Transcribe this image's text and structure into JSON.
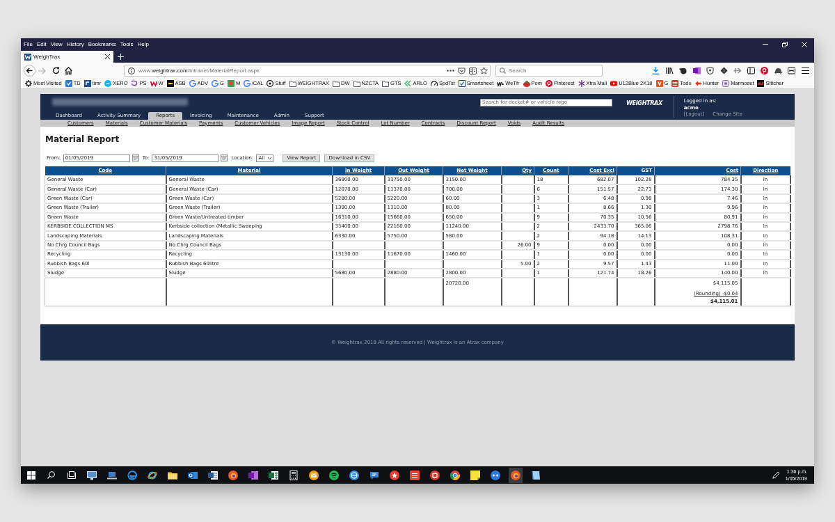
{
  "browser": {
    "menu": [
      "File",
      "Edit",
      "View",
      "History",
      "Bookmarks",
      "Tools",
      "Help"
    ],
    "tabs": [
      {
        "label": "WeighTrax",
        "selected": true
      }
    ],
    "forward_disabled": true,
    "url": {
      "prefix": "www.",
      "domain": "weightrax.com",
      "path": "/Intranet/MaterialReport.aspx"
    },
    "search": {
      "placeholder": "Search"
    },
    "bookmarks": [
      {
        "label": "Most Visited",
        "kind": "menu"
      },
      {
        "label": "TD",
        "kind": "link"
      },
      {
        "label": "timr",
        "kind": "link"
      },
      {
        "label": "XERO",
        "kind": "link"
      },
      {
        "label": "PS",
        "kind": "link"
      },
      {
        "label": "W",
        "kind": "link"
      },
      {
        "label": "ASB",
        "kind": "link"
      },
      {
        "label": "ADV",
        "kind": "link"
      },
      {
        "label": "G",
        "kind": "link"
      },
      {
        "label": "M",
        "kind": "link"
      },
      {
        "label": "iCAL",
        "kind": "link"
      },
      {
        "label": "Stuff",
        "kind": "link"
      },
      {
        "label": "WEIGHTRAX",
        "kind": "folder"
      },
      {
        "label": "DW",
        "kind": "folder"
      },
      {
        "label": "NZCTA",
        "kind": "folder"
      },
      {
        "label": "GTS",
        "kind": "folder"
      },
      {
        "label": "ARLO",
        "kind": "link"
      },
      {
        "label": "SpdTst",
        "kind": "link"
      },
      {
        "label": "Smartsheet",
        "kind": "link"
      },
      {
        "label": "WeTfr",
        "kind": "link"
      },
      {
        "label": "Pom",
        "kind": "link"
      },
      {
        "label": "Pinterest",
        "kind": "link"
      },
      {
        "label": "Xtra Mail",
        "kind": "link"
      },
      {
        "label": "U12Blue 2K18",
        "kind": "link"
      },
      {
        "label": "G",
        "kind": "link"
      },
      {
        "label": "Todo",
        "kind": "link"
      },
      {
        "label": "Hunter",
        "kind": "link"
      },
      {
        "label": "Marmoset",
        "kind": "link"
      },
      {
        "label": "Stitcher",
        "kind": "link"
      }
    ]
  },
  "site": {
    "search": {
      "placeholder": "Search for docket# or vehicle rego"
    },
    "logo": "WEIGHTRAX",
    "user": {
      "caption": "Logged in as:",
      "name": "acme",
      "links": [
        "[Logout]",
        "Change Site"
      ]
    },
    "nav": [
      {
        "label": "Dashboard",
        "selected": false
      },
      {
        "label": "Activity Summary",
        "selected": false
      },
      {
        "label": "Reports",
        "selected": true
      },
      {
        "label": "Invoicing",
        "selected": false
      },
      {
        "label": "Maintenance",
        "selected": false
      },
      {
        "label": "Admin",
        "selected": false
      },
      {
        "label": "Support",
        "selected": false
      }
    ],
    "subnav": [
      "Customers",
      "Materials",
      "Customer Materials",
      "Payments",
      "Customer Vehicles",
      "Image Report",
      "Stock Control",
      "Lot Number",
      "Contracts",
      "Discount Report",
      "Voids",
      "Audit Results"
    ]
  },
  "report": {
    "title": "Material Report",
    "from": {
      "label": "From:",
      "value": "01/05/2019"
    },
    "to": {
      "label": "To:",
      "value": "31/05/2019"
    },
    "location": {
      "label": "Location:",
      "value": "All"
    },
    "buttons": [
      "View Report",
      "Download in CSV"
    ]
  },
  "table": {
    "columns": [
      {
        "label": "Code",
        "sortable": true
      },
      {
        "label": "Material",
        "sortable": true
      },
      {
        "label": "In Weight",
        "sortable": true
      },
      {
        "label": "Out Weight",
        "sortable": true
      },
      {
        "label": "Net Weight",
        "sortable": true
      },
      {
        "label": "Qty",
        "sortable": true
      },
      {
        "label": "Count",
        "sortable": true
      },
      {
        "label": "Cost Excl",
        "sortable": true
      },
      {
        "label": "GST",
        "sortable": false
      },
      {
        "label": "Cost",
        "sortable": true
      },
      {
        "label": "Direction",
        "sortable": true
      }
    ],
    "rows": [
      {
        "code": "General Waste",
        "material": "General Waste",
        "in_weight": "36900.00",
        "out_weight": "33750.00",
        "net_weight": "3150.00",
        "count": "18",
        "cost_excl": "682.07",
        "gst": "102.28",
        "cost": "784.35",
        "direction": "In"
      },
      {
        "code": "General Waste (Car)",
        "material": "General Waste (Car)",
        "in_weight": "12070.00",
        "out_weight": "11370.00",
        "net_weight": "700.00",
        "count": "6",
        "cost_excl": "151.57",
        "gst": "22.73",
        "cost": "174.30",
        "direction": "In"
      },
      {
        "code": "Green Waste (Car)",
        "material": "Green Waste (Car)",
        "in_weight": "5280.00",
        "out_weight": "5220.00",
        "net_weight": "60.00",
        "count": "3",
        "cost_excl": "6.48",
        "gst": "0.98",
        "cost": "7.46",
        "direction": "In"
      },
      {
        "code": "Green Waste (Trailer)",
        "material": "Green Waste (Trailer)",
        "in_weight": "1390.00",
        "out_weight": "1310.00",
        "net_weight": "80.00",
        "count": "1",
        "cost_excl": "8.66",
        "gst": "1.30",
        "cost": "9.96",
        "direction": "In"
      },
      {
        "code": "Green Waste",
        "material": "Green Waste/Untreated timber",
        "in_weight": "16310.00",
        "out_weight": "15660.00",
        "net_weight": "650.00",
        "count": "9",
        "cost_excl": "70.35",
        "gst": "10.56",
        "cost": "80.91",
        "direction": "In"
      },
      {
        "code": "KERBSIDE COLLECTION MS",
        "material": "Kerbside collection (Metallic Sweeping",
        "in_weight": "33400.00",
        "out_weight": "22160.00",
        "net_weight": "11240.00",
        "count": "2",
        "cost_excl": "2433.70",
        "gst": "365.06",
        "cost": "2798.76",
        "direction": "In"
      },
      {
        "code": "Landscaping Materials",
        "material": "Landscaping Materials",
        "in_weight": "6330.00",
        "out_weight": "5750.00",
        "net_weight": "580.00",
        "count": "2",
        "cost_excl": "94.18",
        "gst": "14.13",
        "cost": "108.31",
        "direction": "In"
      },
      {
        "code": "No Chrg Council Bags",
        "material": "No Chrg Council Bags",
        "qty": "26.00",
        "count": "9",
        "cost_excl": "0.00",
        "gst": "0.00",
        "cost": "0.00",
        "direction": "In"
      },
      {
        "code": "Recycling",
        "material": "Recycling",
        "in_weight": "13130.00",
        "out_weight": "11670.00",
        "net_weight": "1460.00",
        "count": "1",
        "cost_excl": "0.00",
        "gst": "0.00",
        "cost": "0.00",
        "direction": "In"
      },
      {
        "code": "Rubbish Bags 60l",
        "material": "Rubbish Bags 60litre",
        "qty": "5.00",
        "count": "2",
        "cost_excl": "9.57",
        "gst": "1.43",
        "cost": "11.00",
        "direction": "In"
      },
      {
        "code": "Sludge",
        "material": "Sludge",
        "in_weight": "5680.00",
        "out_weight": "2880.00",
        "net_weight": "2800.00",
        "count": "1",
        "cost_excl": "121.74",
        "gst": "18.26",
        "cost": "140.00",
        "direction": "In"
      }
    ],
    "totals": {
      "net_weight": "20720.00",
      "subtotal": "$4,115.05",
      "rounding": "(Rounding) -$0.04",
      "total": "$4,115.01"
    }
  },
  "footer": {
    "text": "© Weightrax 2018 All rights reserved | Weightrax is an Atrax company"
  },
  "taskbar": {
    "apps": [
      {
        "selected": false
      },
      {
        "selected": false
      },
      {
        "selected": false
      },
      {
        "selected": false
      },
      {
        "selected": false
      },
      {
        "selected": false
      },
      {
        "selected": false
      },
      {
        "selected": false
      },
      {
        "selected": false
      },
      {
        "selected": false
      },
      {
        "selected": false
      },
      {
        "selected": false
      },
      {
        "selected": false
      },
      {
        "selected": false
      },
      {
        "selected": false
      },
      {
        "selected": false
      },
      {
        "selected": false
      },
      {
        "selected": false
      },
      {
        "selected": false
      },
      {
        "selected": false
      },
      {
        "selected": false
      },
      {
        "selected": true
      },
      {
        "selected": false
      }
    ],
    "clock": {
      "time": "1:36 p.m.",
      "date": "1/05/2019"
    }
  }
}
